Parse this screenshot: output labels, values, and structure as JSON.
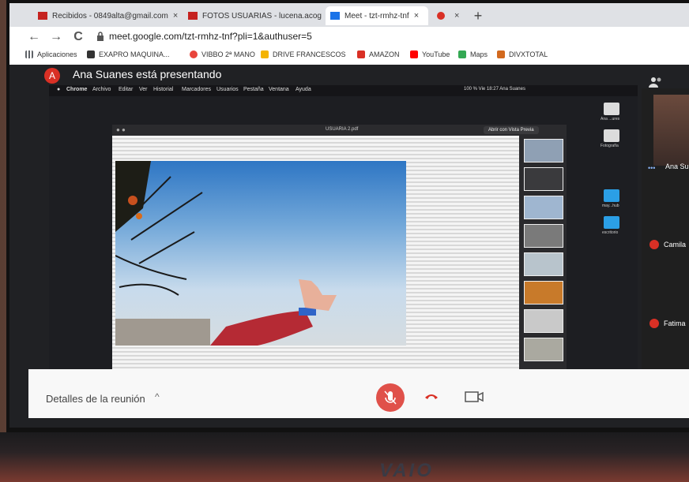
{
  "browser": {
    "tabs": [
      {
        "label": "Recibidos - 0849alta@gmail.com",
        "close": "×",
        "color": "#c5221f"
      },
      {
        "label": "FOTOS USUARIAS - lucena.acoge",
        "close": "×",
        "color": "#c5221f"
      },
      {
        "label": "Meet - tzt-rmhz-tnf",
        "close": "×",
        "color": "#1a73e8"
      },
      {
        "label": "",
        "close": "×",
        "color": "#d93025"
      }
    ],
    "new_tab": "+",
    "back_icon": "←",
    "forward_icon": "→",
    "reload_icon": "C",
    "url": "meet.google.com/tzt-rmhz-tnf?pli=1&authuser=5",
    "bookmarks": [
      {
        "label": "Aplicaciones",
        "color": "#5f6368"
      },
      {
        "label": "EXAPRO MAQUINA...",
        "color": "#333333"
      },
      {
        "label": "VIBBO 2ª MANO",
        "color": "#e8453c"
      },
      {
        "label": "DRIVE FRANCESCOS",
        "color": "#f4b400"
      },
      {
        "label": "AMAZON",
        "color": "#d93025"
      },
      {
        "label": "YouTube",
        "color": "#ff0000"
      },
      {
        "label": "Maps",
        "color": "#34a853"
      },
      {
        "label": "DIVXTOTAL",
        "color": "#d2691e"
      }
    ]
  },
  "meet": {
    "avatar_letter": "A",
    "presenting_text": "Ana Suanes está presentando",
    "details_label": "Detalles de la reunión",
    "details_chevron": "^",
    "participants": [
      {
        "name": "Ana Su"
      },
      {
        "name": "Camila"
      },
      {
        "name": "Fatima"
      }
    ]
  },
  "mac": {
    "menu": [
      "Chrome",
      "Archivo",
      "Editar",
      "Ver",
      "Historial",
      "Marcadores",
      "Usuarios",
      "Pestaña",
      "Ventana",
      "Ayuda"
    ],
    "status": "100 %  Vie 18:27  Ana Suanes",
    "desktop_icons": [
      {
        "label": "Ana ...ures"
      },
      {
        "label": "Fotografía"
      },
      {
        "label": "may...hub"
      },
      {
        "label": "escritorio"
      }
    ],
    "preview": {
      "file_name": "USUARIA 2.pdf",
      "open_button": "Abrir con Vista Previa"
    }
  },
  "laptop": {
    "brand": "VAIO"
  }
}
